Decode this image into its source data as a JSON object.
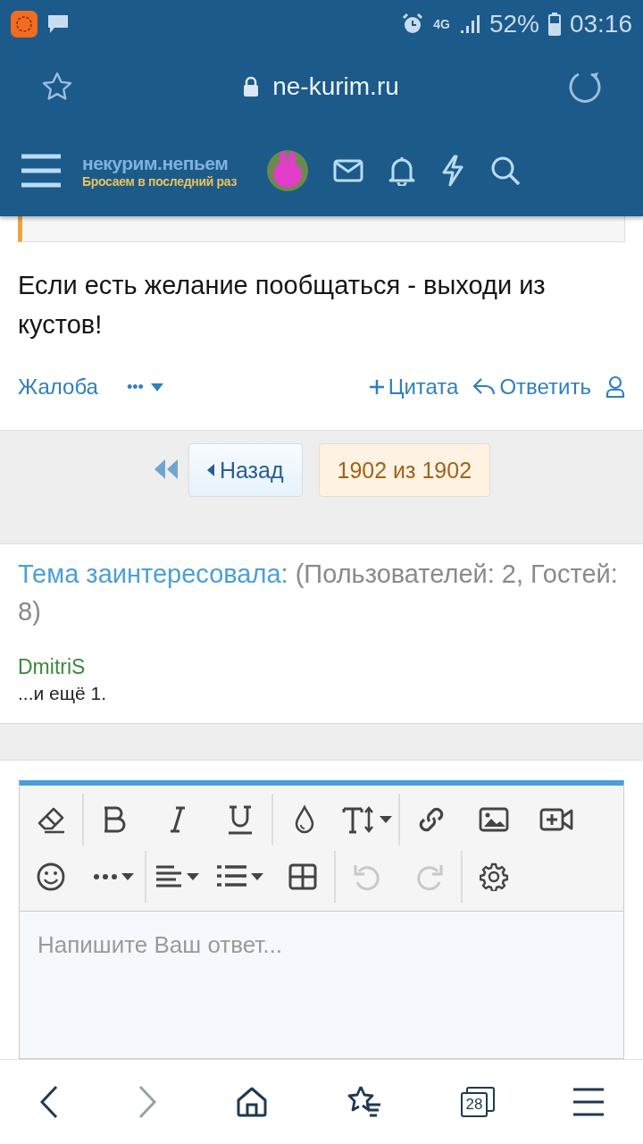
{
  "status_bar": {
    "network": "4G",
    "battery": "52%",
    "time": "03:16"
  },
  "address_bar": {
    "url": "ne-kurim.ru"
  },
  "site_header": {
    "logo_title": "некурим.непьем",
    "logo_subtitle": "Бросаем в последний раз"
  },
  "post": {
    "text": "Если есть желание пообщаться - выходи из кустов!",
    "actions": {
      "report": "Жалоба",
      "more": "•••",
      "quote": "Цитата",
      "reply": "Ответить"
    }
  },
  "pagination": {
    "prev": "Назад",
    "current": "1902 из 1902"
  },
  "viewers": {
    "title": "Тема заинтересовала:",
    "counts": "(Пользователей: 2, Гостей: 8)",
    "users": [
      "DmitriS"
    ],
    "more": "...и ещё 1."
  },
  "editor": {
    "toolbar": [
      {
        "groups": [
          {
            "buttons": [
              {
                "kind": "eraser",
                "disabled": false,
                "menu": false
              }
            ]
          },
          {
            "buttons": [
              {
                "kind": "bold",
                "disabled": false,
                "menu": false
              },
              {
                "kind": "italic",
                "disabled": false,
                "menu": false
              },
              {
                "kind": "underline",
                "disabled": false,
                "menu": false
              }
            ]
          },
          {
            "buttons": [
              {
                "kind": "color",
                "disabled": false,
                "menu": false
              },
              {
                "kind": "size",
                "disabled": false,
                "menu": true
              }
            ]
          },
          {
            "buttons": [
              {
                "kind": "link",
                "disabled": false,
                "menu": false
              },
              {
                "kind": "image",
                "disabled": false,
                "menu": false
              },
              {
                "kind": "video",
                "disabled": false,
                "menu": false
              }
            ]
          }
        ]
      },
      {
        "groups": [
          {
            "buttons": [
              {
                "kind": "smile",
                "disabled": false,
                "menu": false
              },
              {
                "kind": "more",
                "disabled": false,
                "menu": true
              }
            ]
          },
          {
            "buttons": [
              {
                "kind": "align",
                "disabled": false,
                "menu": true
              },
              {
                "kind": "list",
                "disabled": false,
                "menu": true
              },
              {
                "kind": "table",
                "disabled": false,
                "menu": false
              }
            ]
          },
          {
            "buttons": [
              {
                "kind": "undo",
                "disabled": true,
                "menu": false
              },
              {
                "kind": "redo",
                "disabled": true,
                "menu": false
              }
            ]
          },
          {
            "buttons": [
              {
                "kind": "settings",
                "disabled": false,
                "menu": false
              }
            ]
          }
        ]
      }
    ],
    "placeholder": "Напишите Ваш ответ..."
  },
  "bottom_nav": [
    {
      "kind": "back",
      "disabled": false
    },
    {
      "kind": "forward",
      "disabled": true
    },
    {
      "kind": "home",
      "disabled": false
    },
    {
      "kind": "bookmarks",
      "disabled": false
    },
    {
      "kind": "tabs",
      "disabled": false,
      "count": "28"
    },
    {
      "kind": "menu",
      "disabled": false
    }
  ]
}
